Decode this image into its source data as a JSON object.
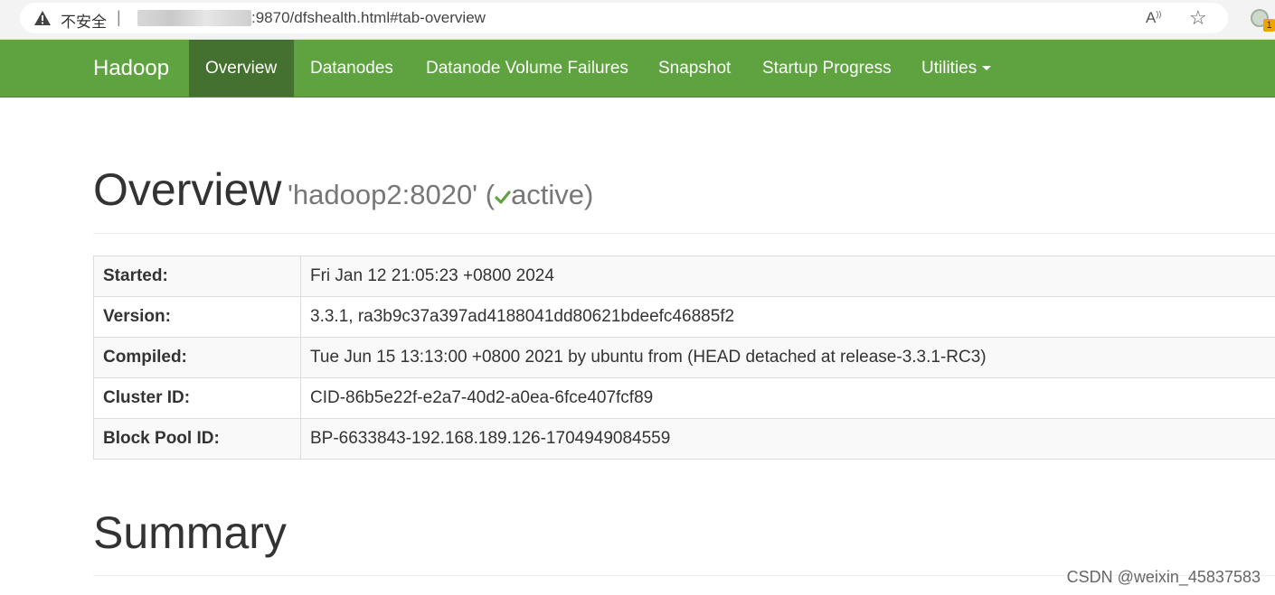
{
  "browser": {
    "security_label": "不安全",
    "separator": "|",
    "url_visible": ":9870/dfshealth.html#tab-overview",
    "read_aloud_label": "A⁾",
    "favorite_glyph": "☆",
    "profile_badge": "1"
  },
  "navbar": {
    "brand": "Hadoop",
    "items": [
      {
        "label": "Overview",
        "active": true
      },
      {
        "label": "Datanodes",
        "active": false
      },
      {
        "label": "Datanode Volume Failures",
        "active": false
      },
      {
        "label": "Snapshot",
        "active": false
      },
      {
        "label": "Startup Progress",
        "active": false
      },
      {
        "label": "Utilities",
        "active": false,
        "dropdown": true
      }
    ]
  },
  "overview": {
    "title": "Overview",
    "host": "'hadoop2:8020'",
    "status_open": "(",
    "status": "active",
    "status_close": ")",
    "status_color": "#5fa341"
  },
  "info_table": [
    {
      "label": "Started:",
      "value": "Fri Jan 12 21:05:23 +0800 2024"
    },
    {
      "label": "Version:",
      "value": "3.3.1, ra3b9c37a397ad4188041dd80621bdeefc46885f2"
    },
    {
      "label": "Compiled:",
      "value": "Tue Jun 15 13:13:00 +0800 2021 by ubuntu from (HEAD detached at release-3.3.1-RC3)"
    },
    {
      "label": "Cluster ID:",
      "value": "CID-86b5e22f-e2a7-40d2-a0ea-6fce407fcf89"
    },
    {
      "label": "Block Pool ID:",
      "value": "BP-6633843-192.168.189.126-1704949084559"
    }
  ],
  "summary": {
    "title": "Summary"
  },
  "watermark": "CSDN @weixin_45837583",
  "colors": {
    "navbar": "#5fa341",
    "navbar_active": "#44712f"
  }
}
